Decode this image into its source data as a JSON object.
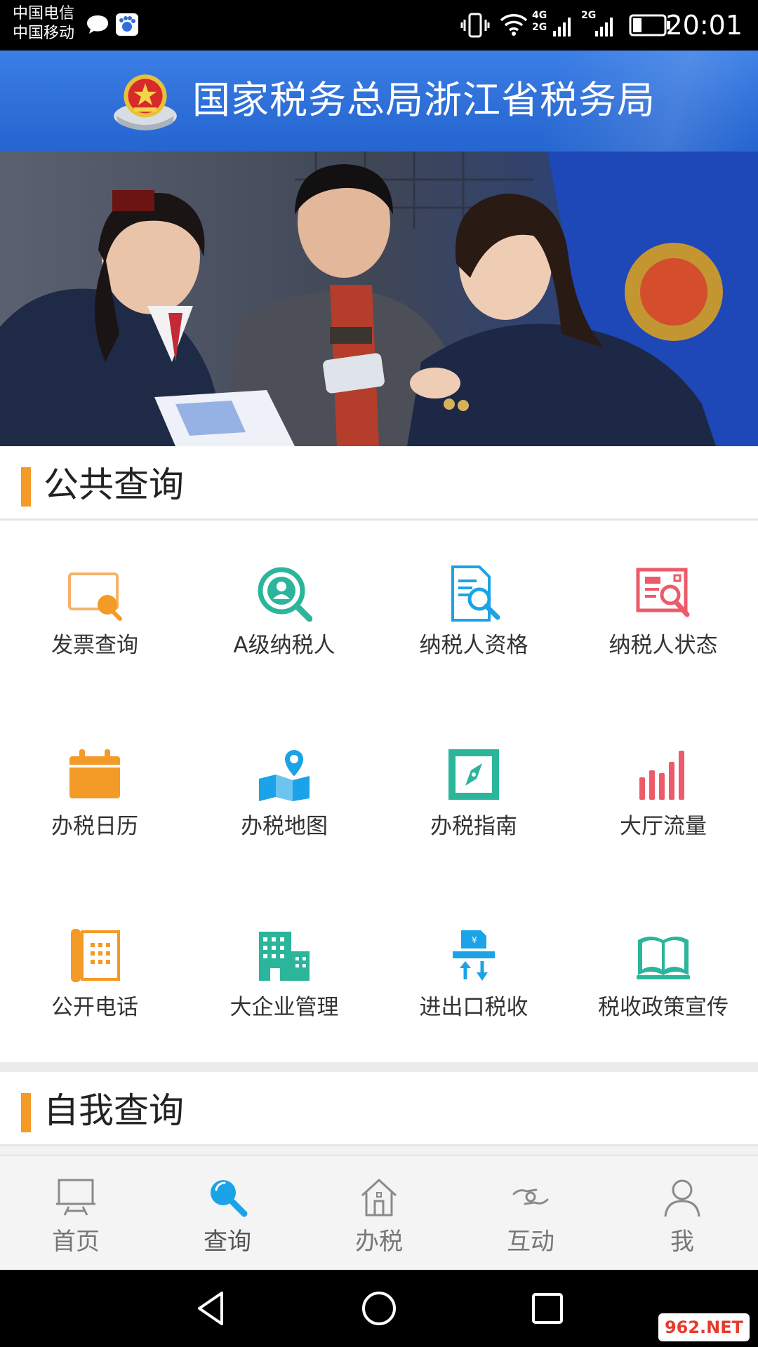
{
  "status_bar": {
    "carrier_1": "中国电信",
    "carrier_2": "中国移动",
    "network_1": "4G",
    "network_2": "2G",
    "network_3": "2G",
    "time": "20:01"
  },
  "header": {
    "title": "国家税务总局浙江省税务局"
  },
  "sections": {
    "public_query": {
      "title": "公共查询"
    },
    "self_query": {
      "title": "自我查询"
    }
  },
  "grid": [
    {
      "label": "发票查询",
      "icon": "invoice-search-icon",
      "color": "#f4a23a"
    },
    {
      "label": "A级纳税人",
      "icon": "user-search-icon",
      "color": "#2bb59a"
    },
    {
      "label": "纳税人资格",
      "icon": "document-search-icon",
      "color": "#1aa3e8"
    },
    {
      "label": "纳税人状态",
      "icon": "status-search-icon",
      "color": "#ec5b6a"
    },
    {
      "label": "办税日历",
      "icon": "calendar-icon",
      "color": "#f39a27"
    },
    {
      "label": "办税地图",
      "icon": "map-pin-icon",
      "color": "#1aa3e8"
    },
    {
      "label": "办税指南",
      "icon": "compass-icon",
      "color": "#2bb59a"
    },
    {
      "label": "大厅流量",
      "icon": "bar-chart-icon",
      "color": "#ec5b6a"
    },
    {
      "label": "公开电话",
      "icon": "phone-icon",
      "color": "#f39a27"
    },
    {
      "label": "大企业管理",
      "icon": "building-icon",
      "color": "#2bb59a"
    },
    {
      "label": "进出口税收",
      "icon": "import-export-icon",
      "color": "#1aa3e8"
    },
    {
      "label": "税收政策宣传",
      "icon": "open-book-icon",
      "color": "#2bb59a"
    }
  ],
  "bottom_nav": [
    {
      "label": "首页",
      "icon": "home-screen-icon",
      "active": false
    },
    {
      "label": "查询",
      "icon": "search-icon",
      "active": true
    },
    {
      "label": "办税",
      "icon": "house-icon",
      "active": false
    },
    {
      "label": "互动",
      "icon": "interact-icon",
      "active": false
    },
    {
      "label": "我",
      "icon": "person-icon",
      "active": false
    }
  ],
  "colors": {
    "header_blue": "#2e6fd8",
    "accent_orange": "#f39a27",
    "active_tab": "#1aa3e8"
  },
  "watermark": "962.NET"
}
